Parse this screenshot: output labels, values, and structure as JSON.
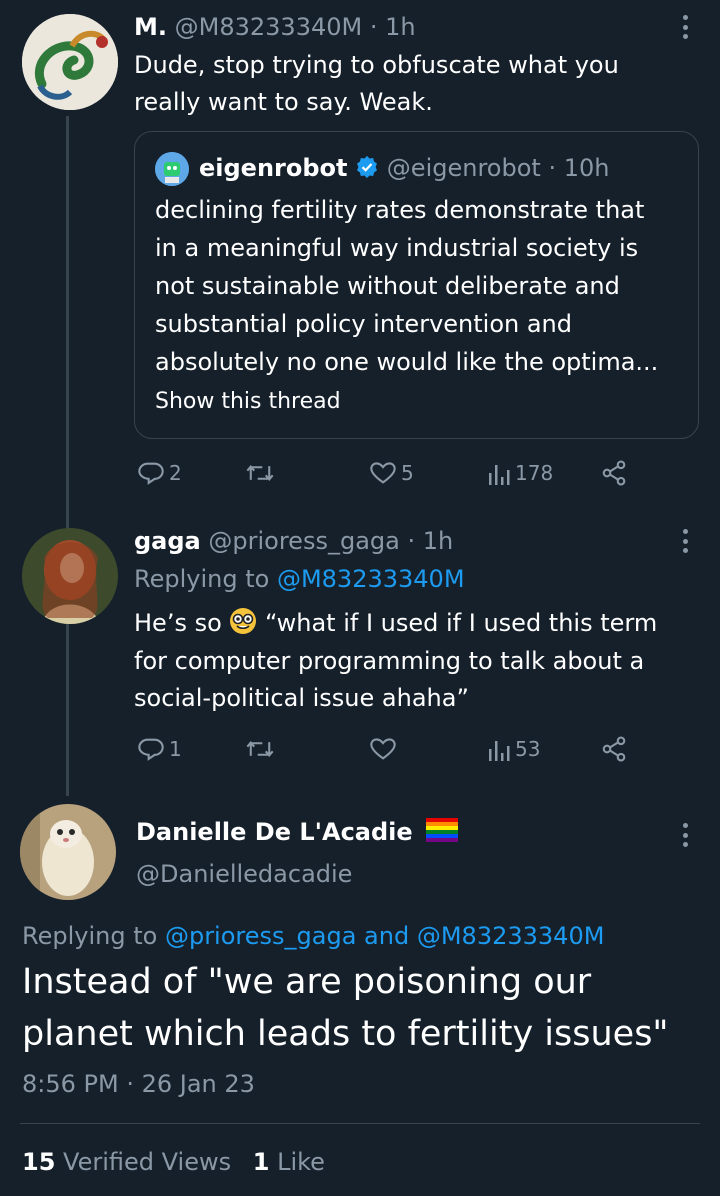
{
  "tweet1": {
    "name": "M.",
    "handle": "@M83233340M",
    "time": "· 1h",
    "text_line1": "Dude, stop trying to obfuscate what you",
    "text_line2": "really want to say. Weak.",
    "quote": {
      "name": "eigenrobot",
      "handle": "@eigenrobot",
      "time": "· 10h",
      "lines": [
        "declining fertility rates demonstrate that",
        "in a meaningful way industrial society is",
        "not sustainable without deliberate and",
        "substantial policy intervention and",
        "absolutely no one would like the optima..."
      ],
      "show_thread": "Show this thread"
    },
    "actions": {
      "replies": "2",
      "retweets": "",
      "likes": "5",
      "views": "178"
    }
  },
  "tweet2": {
    "name": "gaga",
    "handle": "@prioress_gaga",
    "time": "· 1h",
    "replying_to_label": "Replying to",
    "replying_to_handle": "@M83233340M",
    "text_line1a": "He’s so",
    "emoji": "nerd-face-emoji",
    "text_line1b": "“what if I used if I used this term",
    "text_line2": "for computer programming to talk about a",
    "text_line3": "social-political issue ahaha”",
    "actions": {
      "replies": "1",
      "retweets": "",
      "likes": "",
      "views": "53"
    }
  },
  "main_tweet": {
    "name": "Danielle De L'Acadie",
    "handle": "@Danielledacadie",
    "replying_to_label": "Replying to",
    "replying_handle1": "@prioress_gaga",
    "replying_and": "and",
    "replying_handle2": "@M83233340M",
    "text_line1": "Instead of \"we are poisoning our",
    "text_line2": "planet which leads to fertility issues\"",
    "timestamp": "8:56 PM · 26 Jan 23",
    "views_count": "15",
    "views_label": "Verified Views",
    "likes_count": "1",
    "likes_label": "Like"
  },
  "colors": {
    "background": "#15202b",
    "accent": "#1d9bf0",
    "muted": "#8b98a5",
    "border": "#38444d"
  }
}
